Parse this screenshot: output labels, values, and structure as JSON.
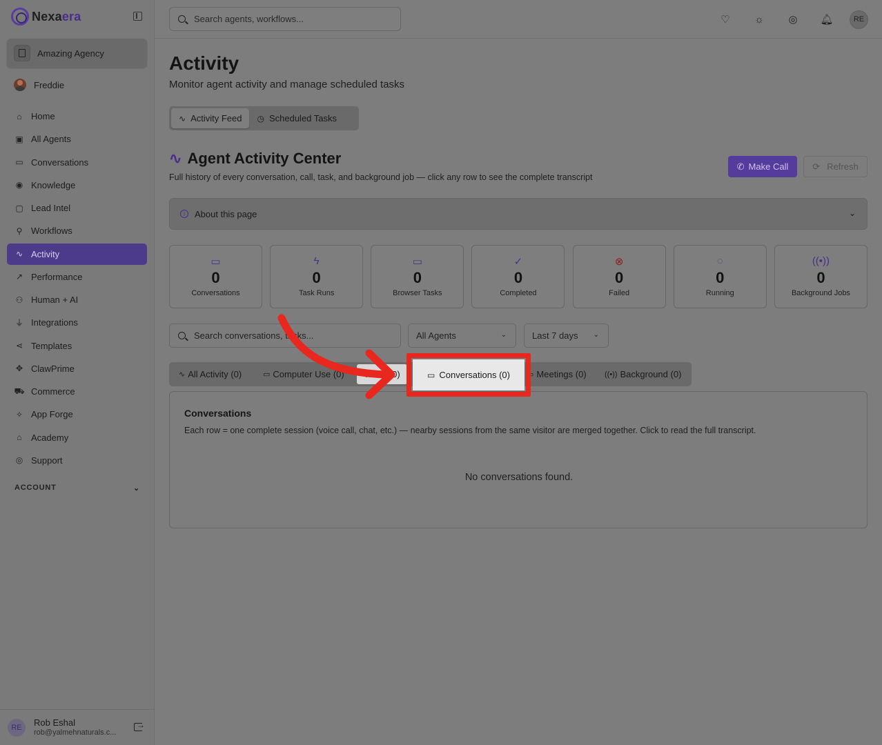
{
  "app": {
    "logo_main": "Nexa",
    "logo_accent": "era"
  },
  "sidebar": {
    "agency": "Amazing Agency",
    "user": "Freddie",
    "items": [
      {
        "label": "Home",
        "icon": "home-icon",
        "glyph": "⌂"
      },
      {
        "label": "All Agents",
        "icon": "bot-icon",
        "glyph": "▣"
      },
      {
        "label": "Conversations",
        "icon": "message-icon",
        "glyph": "▭"
      },
      {
        "label": "Knowledge",
        "icon": "brain-icon",
        "glyph": "◉"
      },
      {
        "label": "Lead Intel",
        "icon": "contact-icon",
        "glyph": "▢"
      },
      {
        "label": "Workflows",
        "icon": "workflow-icon",
        "glyph": "⚲"
      },
      {
        "label": "Activity",
        "icon": "activity-icon",
        "glyph": "∿"
      },
      {
        "label": "Performance",
        "icon": "trending-icon",
        "glyph": "↗"
      },
      {
        "label": "Human + AI",
        "icon": "network-icon",
        "glyph": "⚇"
      },
      {
        "label": "Integrations",
        "icon": "plug-icon",
        "glyph": "⏚"
      },
      {
        "label": "Templates",
        "icon": "share-icon",
        "glyph": "⋖"
      },
      {
        "label": "ClawPrime",
        "icon": "paw-icon",
        "glyph": "✥"
      },
      {
        "label": "Commerce",
        "icon": "cart-icon",
        "glyph": "⛟"
      },
      {
        "label": "App Forge",
        "icon": "sparkles-icon",
        "glyph": "✧"
      },
      {
        "label": "Academy",
        "icon": "graduation-icon",
        "glyph": "⌂"
      },
      {
        "label": "Support",
        "icon": "lifebuoy-icon",
        "glyph": "◎"
      }
    ],
    "account_label": "ACCOUNT",
    "footer": {
      "initials": "RE",
      "name": "Rob Eshal",
      "email": "rob@yalmehnaturals.c..."
    }
  },
  "header": {
    "search_placeholder": "Search agents, workflows...",
    "avatar": "RE"
  },
  "main": {
    "title": "Activity",
    "subtitle": "Monitor agent activity and manage scheduled tasks",
    "view_tabs": [
      {
        "label": "Activity Feed",
        "active": true
      },
      {
        "label": "Scheduled Tasks",
        "active": false
      }
    ],
    "center_title": "Agent Activity Center",
    "center_sub": "Full history of every conversation, call, task, and background job — click any row to see the complete transcript",
    "make_call": "Make Call",
    "refresh": "Refresh",
    "about": "About this page",
    "stats": [
      {
        "value": "0",
        "label": "Conversations",
        "icon": "message-icon",
        "glyph": "▭"
      },
      {
        "value": "0",
        "label": "Task Runs",
        "icon": "zap-icon",
        "glyph": "ϟ"
      },
      {
        "value": "0",
        "label": "Browser Tasks",
        "icon": "monitor-icon",
        "glyph": "▭"
      },
      {
        "value": "0",
        "label": "Completed",
        "icon": "check-circle-icon",
        "glyph": "✓"
      },
      {
        "value": "0",
        "label": "Failed",
        "icon": "x-circle-icon",
        "glyph": "⊗"
      },
      {
        "value": "0",
        "label": "Running",
        "icon": "loader-icon",
        "glyph": "◌"
      },
      {
        "value": "0",
        "label": "Background Jobs",
        "icon": "radio-icon",
        "glyph": "((•))"
      }
    ],
    "filter_search": "Search conversations, tasks...",
    "agents_select": "All Agents",
    "days_select": "Last 7 days",
    "filter_tabs": [
      {
        "label": "All Activity (0)",
        "glyph": "∿"
      },
      {
        "label": "Computer Use (0)",
        "glyph": "▭"
      },
      {
        "label": "Tasks (0)",
        "glyph": "▢"
      },
      {
        "label": "Conversations (0)",
        "glyph": "▭"
      },
      {
        "label": "Meetings (0)",
        "glyph": "▭"
      },
      {
        "label": "Background (0)",
        "glyph": "((•))"
      }
    ],
    "conversations": {
      "title": "Conversations",
      "sub": "Each row = one complete session (voice call, chat, etc.) — nearby sessions from the same visitor are merged together. Click to read the full transcript.",
      "empty": "No conversations found."
    }
  },
  "colors": {
    "accent": "#4c3a8a",
    "highlight": "#e8281e"
  }
}
